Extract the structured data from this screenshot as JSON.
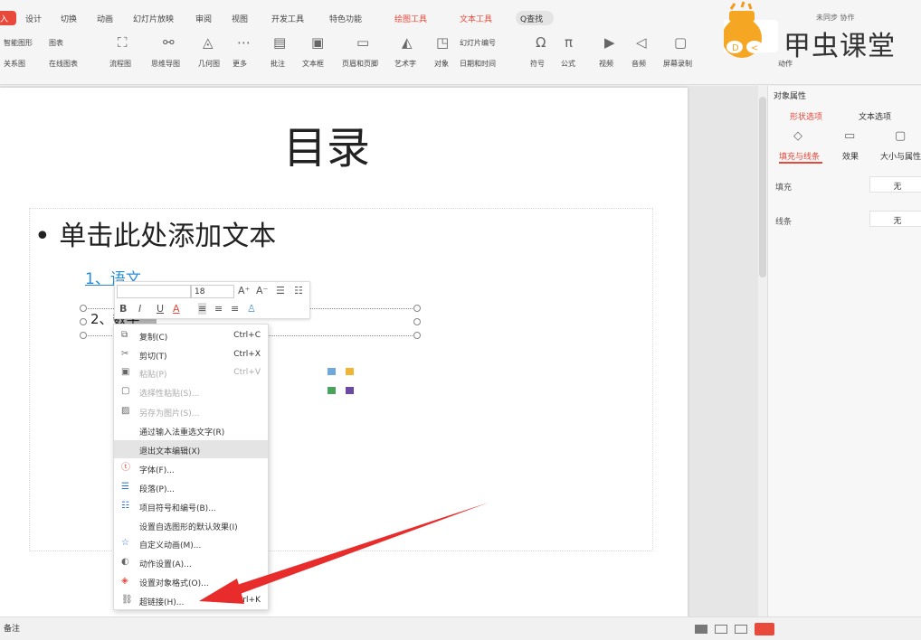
{
  "menubar": {
    "active_tab": "入",
    "tabs": [
      "设计",
      "切换",
      "动画",
      "幻灯片放映",
      "审阅",
      "视图",
      "开发工具",
      "特色功能",
      "绘图工具",
      "文本工具"
    ],
    "search": "Q查找",
    "topright": "未同步  协作"
  },
  "ribbon": {
    "row1": [
      "智能图形",
      "图表"
    ],
    "row2": [
      "关系图",
      "在线图表",
      "流程图",
      "思维导图",
      "几何图",
      "更多",
      "批注",
      "文本框",
      "页眉和页脚",
      "艺术字",
      "对象",
      "日期和时间",
      "符号",
      "公式",
      "视频",
      "音频",
      "屏幕录制"
    ],
    "slide_number": "幻灯片编号",
    "action": "动作"
  },
  "logo": {
    "text": "甲虫课堂"
  },
  "slide": {
    "title": "目录",
    "bullet": "• 单击此处添加文本",
    "item1": "1、语文",
    "item2_prefix": "2、",
    "item2_selected": "数学"
  },
  "minitoolbar": {
    "font_size": "18",
    "buttons": [
      "B",
      "I",
      "U",
      "A"
    ]
  },
  "context_menu": [
    {
      "icon": "copy-icon",
      "label": "复制(C)",
      "shortcut": "Ctrl+C",
      "disabled": false
    },
    {
      "icon": "cut-icon",
      "label": "剪切(T)",
      "shortcut": "Ctrl+X",
      "disabled": false
    },
    {
      "icon": "paste-icon",
      "label": "粘贴(P)",
      "shortcut": "Ctrl+V",
      "disabled": true
    },
    {
      "icon": "paste-special-icon",
      "label": "选择性粘贴(S)...",
      "shortcut": "",
      "disabled": true
    },
    {
      "icon": "save-image-icon",
      "label": "另存为图片(S)...",
      "shortcut": "",
      "disabled": true
    },
    {
      "icon": "",
      "label": "通过输入法重选文字(R)",
      "shortcut": "",
      "disabled": false
    },
    {
      "icon": "",
      "label": "退出文本编辑(X)",
      "shortcut": "",
      "disabled": false
    },
    {
      "icon": "font-icon",
      "label": "字体(F)...",
      "shortcut": "",
      "disabled": false
    },
    {
      "icon": "paragraph-icon",
      "label": "段落(P)...",
      "shortcut": "",
      "disabled": false
    },
    {
      "icon": "list-icon",
      "label": "项目符号和编号(B)...",
      "shortcut": "",
      "disabled": false
    },
    {
      "icon": "",
      "label": "设置自选图形的默认效果(I)",
      "shortcut": "",
      "disabled": false
    },
    {
      "icon": "star-icon",
      "label": "自定义动画(M)...",
      "shortcut": "",
      "disabled": false
    },
    {
      "icon": "mouse-icon",
      "label": "动作设置(A)...",
      "shortcut": "",
      "disabled": false
    },
    {
      "icon": "format-icon",
      "label": "设置对象格式(O)...",
      "shortcut": "",
      "disabled": false
    },
    {
      "icon": "link-icon",
      "label": "超链接(H)...",
      "shortcut": "Ctrl+K",
      "disabled": false
    }
  ],
  "pane": {
    "heading": "对象属性",
    "tab_shape": "形状选项",
    "tab_text": "文本选项",
    "sub_fill_line": "填充与线条",
    "sub_effect": "效果",
    "sub_size": "大小与属性",
    "fill_label": "填充",
    "fill_value": "无",
    "line_label": "线条",
    "line_value": "无"
  },
  "status": {
    "notes": "备注"
  },
  "colors": {
    "accent": "#e8493a",
    "link": "#2a8bd6",
    "arrow": "#e82c2c"
  }
}
